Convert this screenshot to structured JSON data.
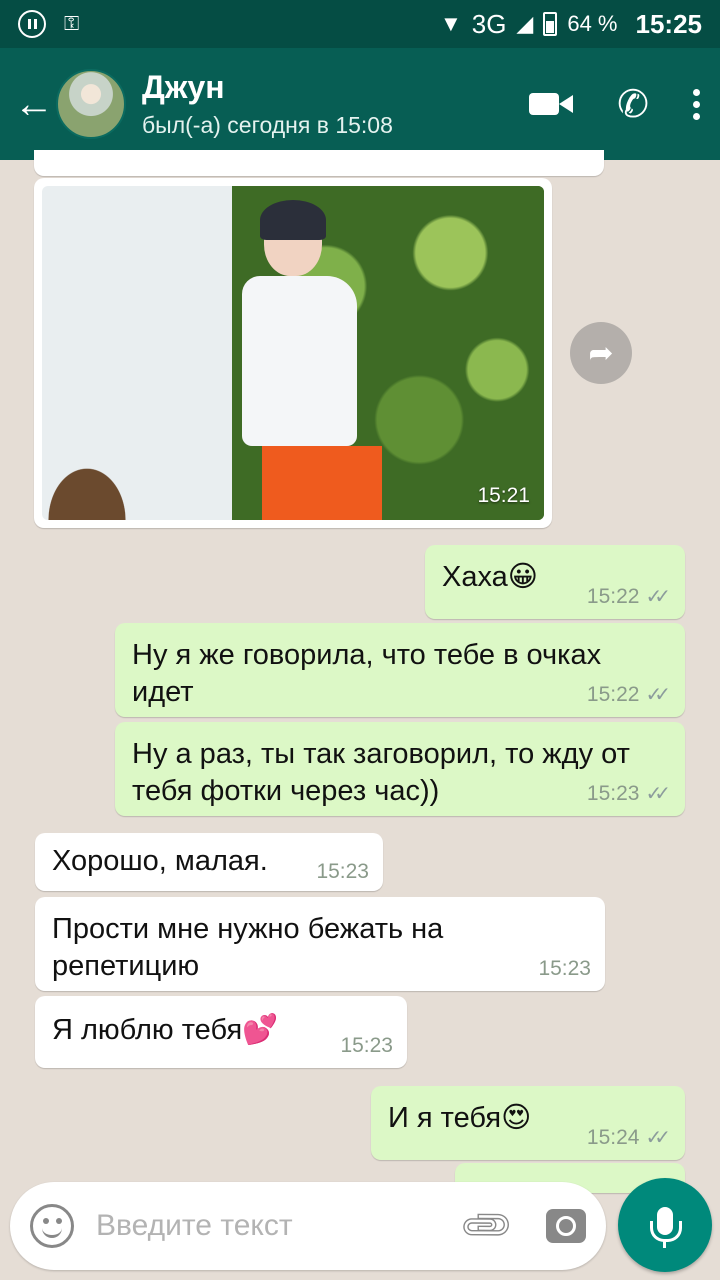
{
  "status_bar": {
    "network": "3G",
    "battery": "64 %",
    "time": "15:25"
  },
  "header": {
    "contact_name": "Джун",
    "last_seen": "был(-а) сегодня в 15:08"
  },
  "messages": [
    {
      "type": "image",
      "direction": "in",
      "time": "15:21"
    },
    {
      "type": "text",
      "direction": "out",
      "text": "Хаха😀",
      "time": "15:22"
    },
    {
      "type": "text",
      "direction": "out",
      "text": "Ну я же говорила, что тебе в очках идет",
      "time": "15:22"
    },
    {
      "type": "text",
      "direction": "out",
      "text": "Ну а раз, ты так заговорил, то жду от тебя фотки через час))",
      "time": "15:23"
    },
    {
      "type": "text",
      "direction": "in",
      "text": "Хорошо, малая.",
      "time": "15:23"
    },
    {
      "type": "text",
      "direction": "in",
      "text": "Прости мне нужно бежать на репетицию",
      "time": "15:23"
    },
    {
      "type": "text",
      "direction": "in",
      "text": "Я люблю тебя💕",
      "time": "15:23"
    },
    {
      "type": "text",
      "direction": "out",
      "text": "И я тебя😍",
      "time": "15:24"
    }
  ],
  "input": {
    "placeholder": "Введите текст"
  },
  "colors": {
    "header": "#075e54",
    "status_bar": "#054d44",
    "outgoing_bubble": "#dcf8c6",
    "incoming_bubble": "#ffffff",
    "fab": "#00897b"
  }
}
